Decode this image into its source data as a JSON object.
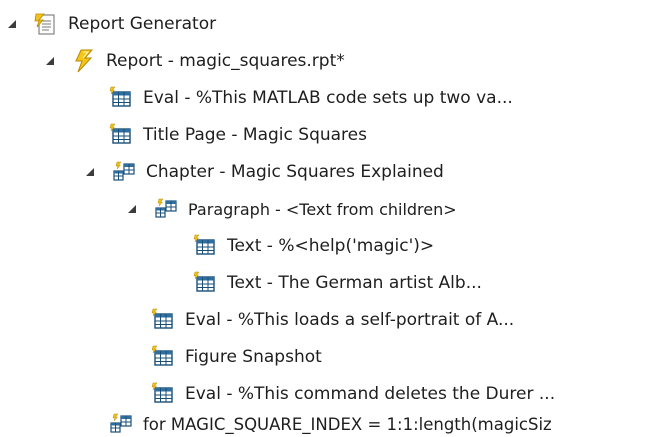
{
  "tree": {
    "items": [
      {
        "label": "Report Generator",
        "icon": "report-generator-icon",
        "expanded": true
      },
      {
        "label": "Report - magic_squares.rpt*",
        "icon": "lightning-icon",
        "expanded": true
      },
      {
        "label": "Eval - %This MATLAB code sets up two va...",
        "icon": "table-icon"
      },
      {
        "label": "Title Page - Magic Squares",
        "icon": "table-icon"
      },
      {
        "label": "Chapter - Magic Squares Explained",
        "icon": "component-tree-icon",
        "expanded": true
      },
      {
        "label": "Paragraph - <Text from children>",
        "icon": "component-tree-icon",
        "expanded": true
      },
      {
        "label": "Text - %<help('magic')>",
        "icon": "table-icon"
      },
      {
        "label": "Text - The German artist Alb...",
        "icon": "table-icon"
      },
      {
        "label": "Eval - %This loads a self-portrait of A...",
        "icon": "table-icon"
      },
      {
        "label": "Figure Snapshot",
        "icon": "table-icon"
      },
      {
        "label": "Eval - %This command deletes the Durer ...",
        "icon": "table-icon"
      },
      {
        "label": "for MAGIC_SQUARE_INDEX = 1:1:length(magicSiz",
        "icon": "component-tree-icon"
      }
    ]
  }
}
